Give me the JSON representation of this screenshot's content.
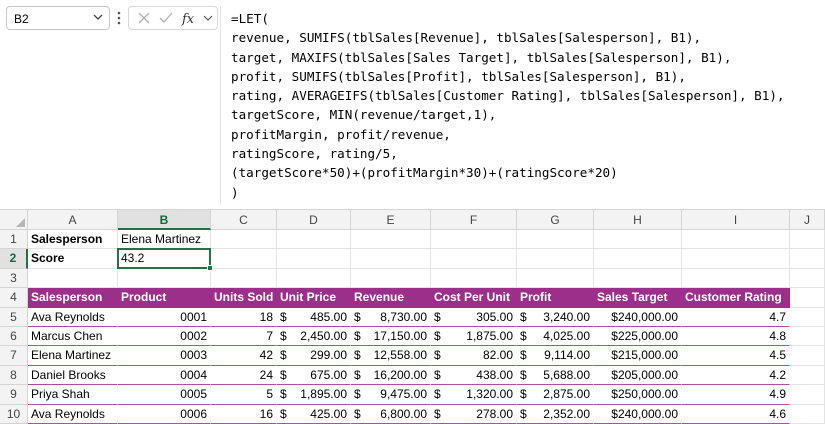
{
  "name_box": {
    "value": "B2"
  },
  "formula_lines": [
    "=LET(",
    "revenue, SUMIFS(tblSales[Revenue], tblSales[Salesperson], B1),",
    "target, MAXIFS(tblSales[Sales Target], tblSales[Salesperson], B1),",
    "profit, SUMIFS(tblSales[Profit], tblSales[Salesperson], B1),",
    "rating, AVERAGEIFS(tblSales[Customer Rating], tblSales[Salesperson], B1),",
    "targetScore, MIN(revenue/target,1),",
    "profitMargin, profit/revenue,",
    "ratingScore, rating/5,",
    "(targetScore*50)+(profitMargin*30)+(ratingScore*20)",
    ")"
  ],
  "columns": [
    "A",
    "B",
    "C",
    "D",
    "E",
    "F",
    "G",
    "H",
    "I",
    "J"
  ],
  "rows": [
    "1",
    "2",
    "3",
    "4",
    "5",
    "6",
    "7",
    "8",
    "9",
    "10"
  ],
  "summary": {
    "label1": "Salesperson",
    "value1": "Elena Martinez",
    "label2": "Score",
    "value2": "43.2"
  },
  "table": {
    "headers": [
      "Salesperson",
      "Product",
      "Units Sold",
      "Unit Price",
      "Revenue",
      "Cost Per Unit",
      "Profit",
      "Sales Target",
      "Customer Rating"
    ],
    "rows": [
      {
        "salesperson": "Ava Reynolds",
        "product": "0001",
        "units": "18",
        "price_sym": "$",
        "price": "485.00",
        "rev_sym": "$",
        "rev": "8,730.00",
        "cost_sym": "$",
        "cost": "305.00",
        "profit_sym": "$",
        "profit": "3,240.00",
        "target": "$240,000.00",
        "rating": "4.7"
      },
      {
        "salesperson": "Marcus Chen",
        "product": "0002",
        "units": "7",
        "price_sym": "$",
        "price": "2,450.00",
        "rev_sym": "$",
        "rev": "17,150.00",
        "cost_sym": "$",
        "cost": "1,875.00",
        "profit_sym": "$",
        "profit": "4,025.00",
        "target": "$225,000.00",
        "rating": "4.8"
      },
      {
        "salesperson": "Elena Martinez",
        "product": "0003",
        "units": "42",
        "price_sym": "$",
        "price": "299.00",
        "rev_sym": "$",
        "rev": "12,558.00",
        "cost_sym": "$",
        "cost": "82.00",
        "profit_sym": "$",
        "profit": "9,114.00",
        "target": "$215,000.00",
        "rating": "4.5"
      },
      {
        "salesperson": "Daniel Brooks",
        "product": "0004",
        "units": "24",
        "price_sym": "$",
        "price": "675.00",
        "rev_sym": "$",
        "rev": "16,200.00",
        "cost_sym": "$",
        "cost": "438.00",
        "profit_sym": "$",
        "profit": "5,688.00",
        "target": "$205,000.00",
        "rating": "4.2"
      },
      {
        "salesperson": "Priya Shah",
        "product": "0005",
        "units": "5",
        "price_sym": "$",
        "price": "1,895.00",
        "rev_sym": "$",
        "rev": "9,475.00",
        "cost_sym": "$",
        "cost": "1,320.00",
        "profit_sym": "$",
        "profit": "2,875.00",
        "target": "$250,000.00",
        "rating": "4.9"
      },
      {
        "salesperson": "Ava Reynolds",
        "product": "0006",
        "units": "16",
        "price_sym": "$",
        "price": "425.00",
        "rev_sym": "$",
        "rev": "6,800.00",
        "cost_sym": "$",
        "cost": "278.00",
        "profit_sym": "$",
        "profit": "2,352.00",
        "target": "$240,000.00",
        "rating": "4.6"
      }
    ]
  },
  "colors": {
    "table_header": "#9b2f8a",
    "selection": "#217346"
  },
  "icons": {
    "name_box_dropdown": "chevron-down-icon",
    "more": "more-vertical-icon",
    "cancel": "cancel-icon",
    "enter": "check-icon",
    "function": "fx-icon",
    "formula_dropdown": "chevron-down-icon"
  }
}
